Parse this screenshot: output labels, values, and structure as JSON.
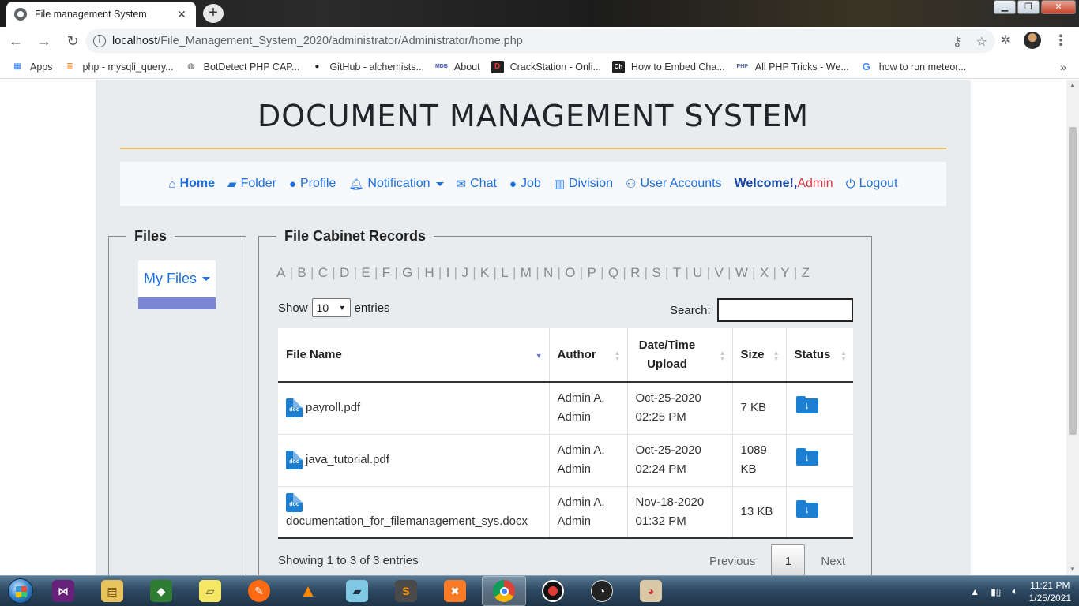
{
  "browser": {
    "tab_title": "File management System",
    "tab_close": "✕",
    "new_tab": "+",
    "url_host": "localhost",
    "url_path": "/File_Management_System_2020/administrator/Administrator/home.php",
    "window_controls": {
      "minimize": "▁",
      "restore": "❐",
      "close": "✕"
    }
  },
  "bookmarks": [
    {
      "label": "Apps",
      "icon": "apps-grid-icon",
      "color": "#1a73e8"
    },
    {
      "label": "php - mysqli_query...",
      "icon": "stackoverflow-icon",
      "color": "#f48024"
    },
    {
      "label": "BotDetect PHP CAP...",
      "icon": "globe-icon",
      "color": "#555555"
    },
    {
      "label": "GitHub - alchemists...",
      "icon": "github-icon",
      "color": "#222222"
    },
    {
      "label": "About",
      "icon": "mdb-icon",
      "color": "#3f51b5"
    },
    {
      "label": "CrackStation - Onli...",
      "icon": "crackstation-icon",
      "color": "#c4161c"
    },
    {
      "label": "How to Embed Cha...",
      "icon": "ch-icon",
      "color": "#222222"
    },
    {
      "label": "All PHP Tricks - We...",
      "icon": "php-icon",
      "color": "#4f5b93"
    },
    {
      "label": "how to run meteor...",
      "icon": "google-icon",
      "color": "#4285f4"
    }
  ],
  "bookmarks_more": "»",
  "site": {
    "title": "DOCUMENT MANAGEMENT SYSTEM",
    "accent_rule_color": "#e5c25a"
  },
  "nav": {
    "home": "Home",
    "folder": "Folder",
    "profile": "Profile",
    "notification": "Notification",
    "chat": "Chat",
    "job": "Job",
    "division": "Division",
    "user_accounts": "User Accounts",
    "welcome": "Welcome!,",
    "welcome_user": "Admin",
    "logout": "Logout"
  },
  "files_panel": {
    "legend": "Files",
    "my_files": "My Files"
  },
  "cabinet": {
    "legend": "File Cabinet Records",
    "alphabet": [
      "A",
      "B",
      "C",
      "D",
      "E",
      "F",
      "G",
      "H",
      "I",
      "J",
      "K",
      "L",
      "M",
      "N",
      "O",
      "P",
      "Q",
      "R",
      "S",
      "T",
      "U",
      "V",
      "W",
      "X",
      "Y",
      "Z"
    ],
    "show_label": "Show",
    "entries_value": "10",
    "entries_label": "entries",
    "search_label": "Search:",
    "search_value": "",
    "columns": [
      "File Name",
      "Author",
      "Date/Time Upload",
      "Size",
      "Status"
    ],
    "rows": [
      {
        "file": "payroll.pdf",
        "author": "Admin A. Admin",
        "date": "Oct-25-2020",
        "time": "02:25 PM",
        "size": "7 KB"
      },
      {
        "file": "java_tutorial.pdf",
        "author": "Admin A. Admin",
        "date": "Oct-25-2020",
        "time": "02:24 PM",
        "size": "1089 KB"
      },
      {
        "file": "documentation_for_filemanagement_sys.docx",
        "author": "Admin A. Admin",
        "date": "Nov-18-2020",
        "time": "01:32 PM",
        "size": "13 KB"
      }
    ],
    "info": "Showing 1 to 3 of 3 entries",
    "previous": "Previous",
    "page": "1",
    "next": "Next"
  },
  "taskbar": {
    "time": "11:21 PM",
    "date": "1/25/2021"
  }
}
